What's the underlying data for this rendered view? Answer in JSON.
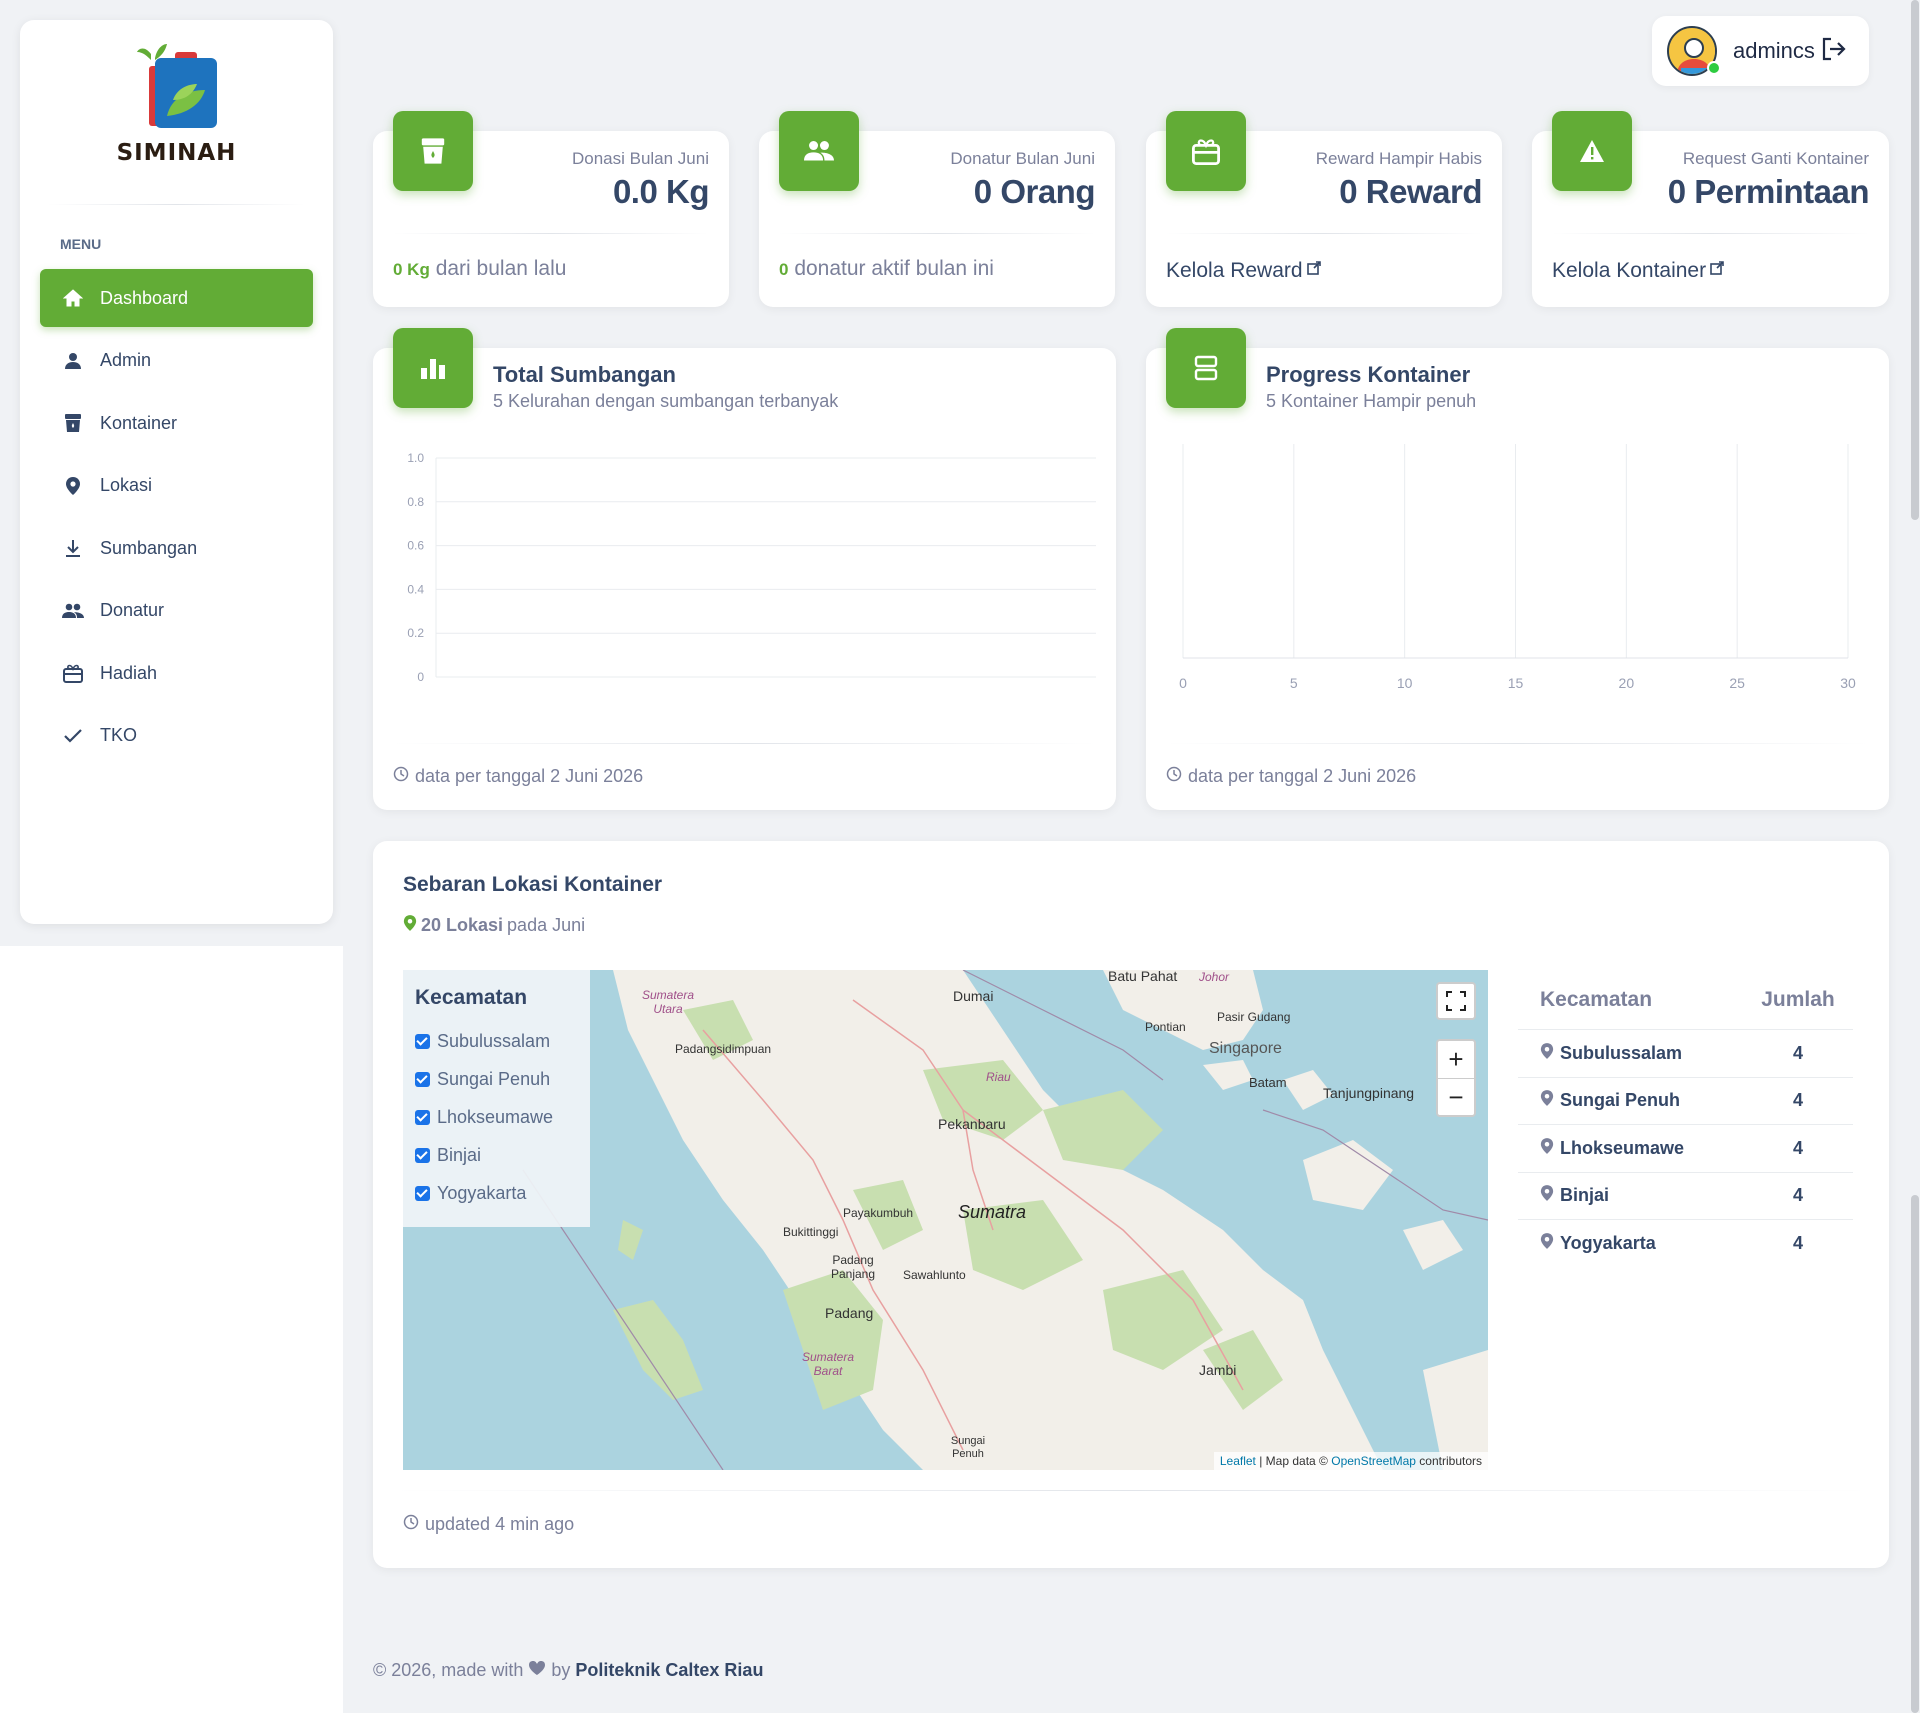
{
  "app": {
    "name": "SIMINAH",
    "menu_title": "MENU"
  },
  "sidebar": {
    "items": [
      {
        "label": "Dashboard",
        "icon": "home-icon",
        "active": true
      },
      {
        "label": "Admin",
        "icon": "person-icon"
      },
      {
        "label": "Kontainer",
        "icon": "container-icon"
      },
      {
        "label": "Lokasi",
        "icon": "location-pin-icon"
      },
      {
        "label": "Sumbangan",
        "icon": "download-icon"
      },
      {
        "label": "Donatur",
        "icon": "people-icon"
      },
      {
        "label": "Hadiah",
        "icon": "gift-icon"
      },
      {
        "label": "TKO",
        "icon": "check-icon"
      }
    ]
  },
  "user": {
    "name": "admincs"
  },
  "stats": [
    {
      "label": "Donasi Bulan Juni",
      "value": "0.0 Kg",
      "foot_strong": "0 Kg",
      "foot": "dari bulan lalu",
      "icon": "container-icon"
    },
    {
      "label": "Donatur Bulan Juni",
      "value": "0 Orang",
      "foot_strong": "0",
      "foot": "donatur aktif bulan ini",
      "icon": "people-icon"
    },
    {
      "label": "Reward Hampir Habis",
      "value": "0 Reward",
      "link": "Kelola Reward",
      "icon": "gift-icon"
    },
    {
      "label": "Request Ganti Kontainer",
      "value": "0 Permintaan",
      "link": "Kelola Kontainer",
      "icon": "warning-icon"
    }
  ],
  "total_sumbangan": {
    "title": "Total Sumbangan",
    "subtitle": "5 Kelurahan dengan sumbangan terbanyak",
    "footer": "data per tanggal 2 Juni 2026"
  },
  "progress_kontainer": {
    "title": "Progress Kontainer",
    "subtitle": "5 Kontainer Hampir penuh",
    "footer": "data per tanggal 2 Juni 2026"
  },
  "chart_data": [
    {
      "type": "bar",
      "categories": [],
      "values": [],
      "yticks": [
        "0",
        "0.2",
        "0.4",
        "0.6",
        "0.8",
        "1.0"
      ],
      "ylim": [
        0,
        1
      ]
    },
    {
      "type": "bar",
      "orientation": "horizontal",
      "categories": [],
      "values": [],
      "xticks": [
        "0",
        "5",
        "10",
        "15",
        "20",
        "25",
        "30"
      ],
      "xlim": [
        0,
        30
      ]
    }
  ],
  "map_section": {
    "title": "Sebaran Lokasi Kontainer",
    "count": "20 Lokasi",
    "count_suffix": "pada Juni",
    "legend_title": "Kecamatan",
    "legend": [
      "Subulussalam",
      "Sungai Penuh",
      "Lhokseumawe",
      "Binjai",
      "Yogyakarta"
    ],
    "attribution_leaflet": "Leaflet",
    "attribution_text": "| Map data ©",
    "attribution_osm": "OpenStreetMap",
    "attribution_suffix": "contributors",
    "places": [
      "Batu Pahat",
      "Johor",
      "Dumai",
      "Sumatera Utara",
      "Pontian",
      "Pasir Gudang",
      "Singapore",
      "Padangsidimpuan",
      "Riau",
      "Batam",
      "Tanjungpinang",
      "Pekanbaru",
      "Payakumbuh",
      "Sumatra",
      "Bukittinggi",
      "Padang Panjang",
      "Sawahlunto",
      "Padang",
      "Sumatera Barat",
      "Jambi",
      "Sungai Penuh"
    ],
    "table_head": [
      "Kecamatan",
      "Jumlah"
    ],
    "table": [
      {
        "name": "Subulussalam",
        "count": "4"
      },
      {
        "name": "Sungai Penuh",
        "count": "4"
      },
      {
        "name": "Lhokseumawe",
        "count": "4"
      },
      {
        "name": "Binjai",
        "count": "4"
      },
      {
        "name": "Yogyakarta",
        "count": "4"
      }
    ],
    "updated": "updated 4 min ago"
  },
  "footer": {
    "text": "© 2026, made with",
    "by": "by",
    "org": "Politeknik Caltex Riau"
  },
  "colors": {
    "accent": "#62ac36",
    "text": "#344767",
    "muted": "#7b809a"
  }
}
